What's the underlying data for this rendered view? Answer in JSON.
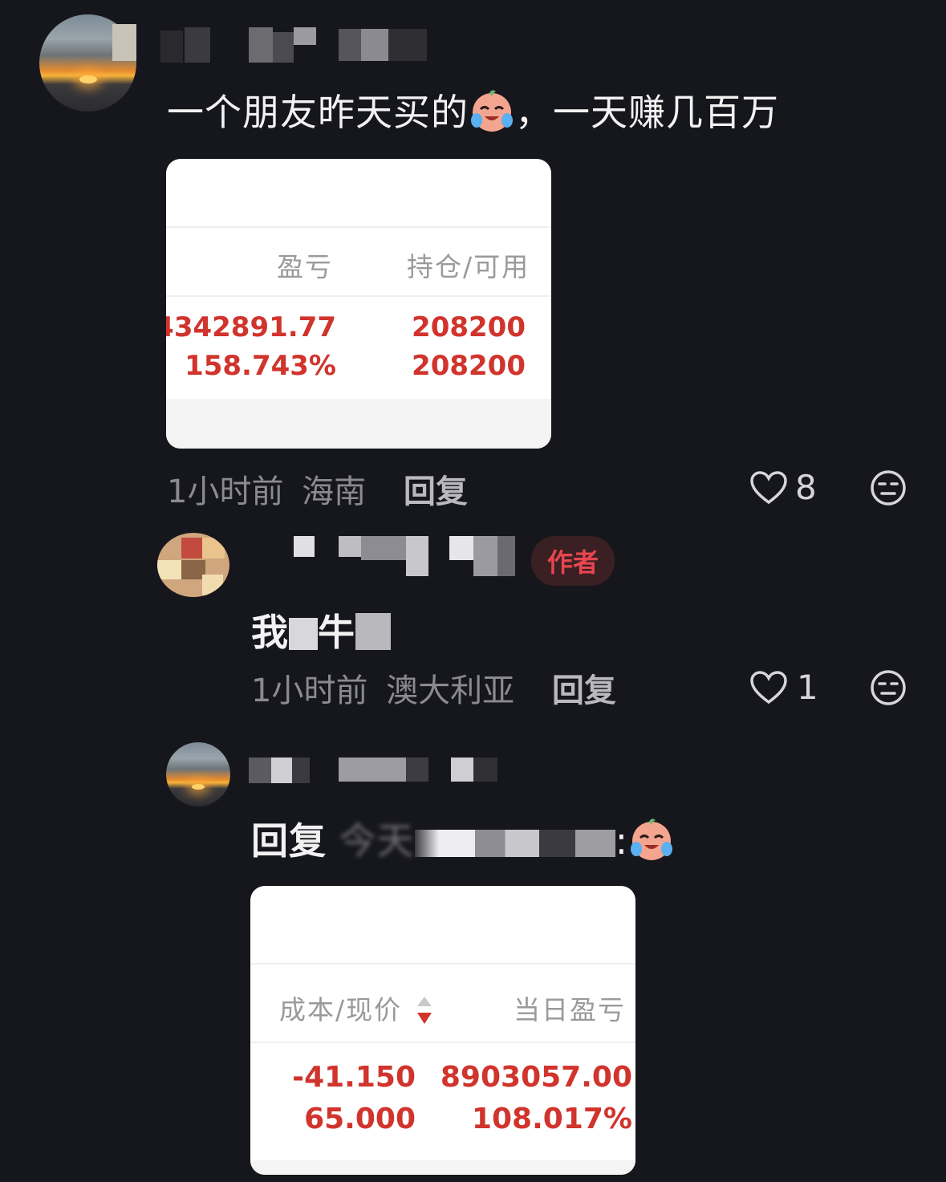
{
  "comment1": {
    "text": "一个朋友昨天买的",
    "text_after": "，一天赚几百万",
    "card": {
      "col1_header": "盈亏",
      "col2_header": "持仓/可用",
      "col1_values": [
        "4342891.77",
        "158.743%"
      ],
      "col2_values": [
        "208200",
        "208200"
      ]
    },
    "time": "1小时前",
    "location": "海南",
    "reply_label": "回复",
    "likes": "8"
  },
  "reply1": {
    "badge": "作者",
    "text_start": "我",
    "text_mid": "牛",
    "time": "1小时前",
    "location": "澳大利亚",
    "reply_label": "回复",
    "likes": "1"
  },
  "reply2": {
    "prefix": "回复",
    "blur_hint": "今天",
    "colon": ":",
    "card": {
      "col1_header": "成本/现价",
      "col2_header": "当日盈亏",
      "col1_values": [
        "-41.150",
        "65.000"
      ],
      "col2_values": [
        "8903057.00",
        "108.017%"
      ]
    }
  },
  "colors": {
    "background": "#16161d",
    "red": "#d0342c",
    "badge_text": "#e8454f"
  },
  "icons": [
    "heart-outline-icon",
    "neutral-face-icon",
    "crying-laughing-emoji",
    "sort-arrows-icon"
  ]
}
